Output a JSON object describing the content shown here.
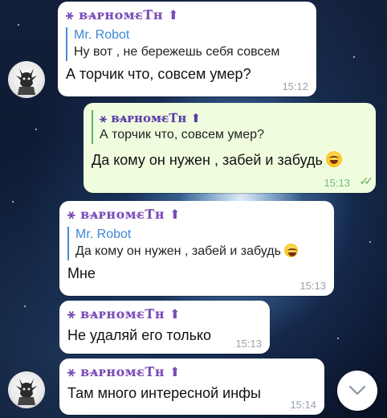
{
  "messages": [
    {
      "sender": "⚹ ʙᴀ̶ᴘнᴏᴍɛ̶Т̄н ⬆",
      "reply_name": "Mr. Robot",
      "reply_text": "Ну вот , не бережешь себя совсем",
      "text": "А торчик что, совсем умер?",
      "time": "15:12"
    },
    {
      "reply_name": "⚹ ʙᴀ̶ᴘнᴏᴍɛ̶Т̄н ⬆",
      "reply_text": "А торчик что, совсем умер?",
      "text": "Да кому он нужен , забей и забудь",
      "emoji": "laughing-face",
      "time": "15:13",
      "status": "read"
    },
    {
      "sender": "⚹ ʙᴀ̶ᴘнᴏᴍɛ̶Т̄н ⬆",
      "reply_name": "Mr. Robot",
      "reply_text": "Да кому он нужен , забей и забудь",
      "reply_emoji": "laughing-face",
      "text": "Мне",
      "time": "15:13"
    },
    {
      "sender": "⚹ ʙᴀ̶ᴘнᴏᴍɛ̶Т̄н ⬆",
      "text": "Не удаляй его только",
      "time": "15:13"
    },
    {
      "sender": "⚹ ʙᴀ̶ᴘнᴏᴍɛ̶Т̄н ⬆",
      "text": "Там много интересной инфы",
      "time": "15:14"
    }
  ],
  "colors": {
    "incoming_bubble": "#ffffff",
    "outgoing_bubble": "#effdde",
    "sender_name": "#7a4cb8",
    "reply_name": "#3e87d6"
  }
}
